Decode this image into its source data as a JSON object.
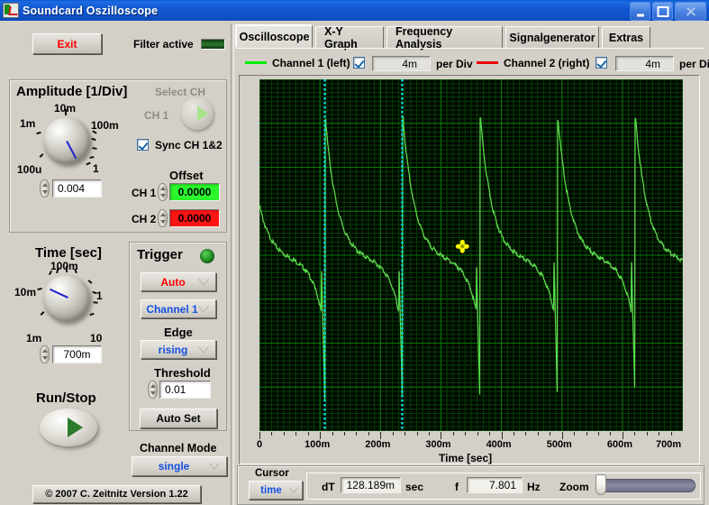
{
  "window": {
    "title": "Soundcard Oszilloscope",
    "icon": "app-icon",
    "buttons": {
      "minimize": "minimize",
      "maximize": "maximize",
      "close": "close"
    }
  },
  "toolbar": {
    "exit_label": "Exit",
    "filter_label": "Filter active"
  },
  "tabs": [
    {
      "label": "Oscilloscope",
      "active": true
    },
    {
      "label": "X-Y Graph",
      "active": false
    },
    {
      "label": "Frequency Analysis",
      "active": false
    },
    {
      "label": "Signalgenerator",
      "active": false
    },
    {
      "label": "Extras",
      "active": false
    }
  ],
  "channels": [
    {
      "name": "Channel 1 (left)",
      "color": "#00ee00",
      "enabled": true,
      "per_div_value": "4m",
      "per_div_label": "per Div"
    },
    {
      "name": "Channel 2 (right)",
      "color": "#ee0000",
      "enabled": true,
      "per_div_value": "4m",
      "per_div_label": "per Div"
    }
  ],
  "amplitude": {
    "title": "Amplitude [1/Div]",
    "knob_ticks": [
      "100u",
      "1m",
      "10m",
      "100m",
      "1"
    ],
    "value": "0.004",
    "select_ch_label": "Select CH",
    "select_ch_value": "CH 1",
    "sync_label": "Sync CH 1&2",
    "sync_checked": true,
    "offset_title": "Offset",
    "offsets": [
      {
        "label": "CH 1",
        "value": "0.0000",
        "color": "#2bf72b"
      },
      {
        "label": "CH 2",
        "value": "0.0000",
        "color": "#ff1414"
      }
    ]
  },
  "time": {
    "title": "Time [sec]",
    "knob_ticks": [
      "1m",
      "10m",
      "100m",
      "1",
      "10"
    ],
    "value": "700m"
  },
  "trigger": {
    "title": "Trigger",
    "led_color": "#1f8a1f",
    "mode": "Auto",
    "mode_color": "#ff0000",
    "source": "Channel 1",
    "source_color": "#1550e0",
    "edge_label": "Edge",
    "edge": "rising",
    "edge_color": "#1550e0",
    "threshold_label": "Threshold",
    "threshold": "0.01",
    "autoset_label": "Auto Set"
  },
  "runstop": {
    "label": "Run/Stop"
  },
  "channel_mode": {
    "label": "Channel Mode",
    "value": "single",
    "value_color": "#1550e0"
  },
  "copyright": "© 2007   C. Zeitnitz Version 1.22",
  "status": {
    "cursor_label": "Cursor",
    "cursor_value": "time",
    "dt_label": "dT",
    "dt_value": "128.189m",
    "dt_unit": "sec",
    "f_label": "f",
    "f_value": "7.801",
    "f_unit": "Hz",
    "zoom_label": "Zoom"
  },
  "chart_data": {
    "type": "line",
    "title": "",
    "xlabel": "Time [sec]",
    "ylabel": "",
    "xlim": [
      0,
      0.7
    ],
    "ylim": [
      -1,
      1
    ],
    "grid": true,
    "background": "#000800",
    "grid_color": "#0d7a0d",
    "grid_minor_color": "#073e07",
    "x_ticks": [
      "0",
      "100m",
      "200m",
      "300m",
      "400m",
      "500m",
      "600m",
      "700m"
    ],
    "x_tick_values": [
      0,
      0.1,
      0.2,
      0.3,
      0.4,
      0.5,
      0.6,
      0.7
    ],
    "divisions_x": 7,
    "divisions_y": 8,
    "cursors": [
      {
        "name": "cursor-1",
        "x": 0.108,
        "color": "#00e0e0",
        "style": "dotted"
      },
      {
        "name": "cursor-2",
        "x": 0.236,
        "color": "#00e0e0",
        "style": "dotted"
      }
    ],
    "marker": {
      "name": "cursor-marker",
      "x": 0.3355,
      "y": 0.05,
      "color": "#ffff00"
    },
    "series": [
      {
        "name": "Channel 1 (left)",
        "color": "#4ee04e",
        "waveform": "damped-pulse",
        "period": 0.1282,
        "phase": 0.108,
        "peak": 0.78,
        "trough": -0.8,
        "decay": 6.0
      },
      {
        "name": "Channel 2 (right)",
        "color": "#c03a1a",
        "waveform": "damped-pulse",
        "period": 0.1282,
        "phase": 0.108,
        "peak": 0.78,
        "trough": -0.8,
        "decay": 6.0
      }
    ]
  }
}
